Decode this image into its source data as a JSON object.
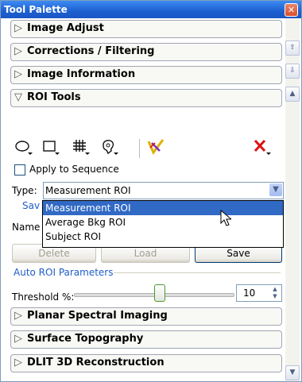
{
  "window": {
    "title": "Tool Palette",
    "close_icon": "close-icon"
  },
  "sections": [
    {
      "label": "Image Adjust",
      "state": "collapsed"
    },
    {
      "label": "Corrections / Filtering",
      "state": "collapsed"
    },
    {
      "label": "Image Information",
      "state": "collapsed"
    },
    {
      "label": "ROI Tools",
      "state": "expanded"
    },
    {
      "label": "Planar Spectral Imaging",
      "state": "collapsed"
    },
    {
      "label": "Surface Topography",
      "state": "collapsed"
    },
    {
      "label": "DLIT 3D Reconstruction",
      "state": "collapsed"
    }
  ],
  "roi_tools": {
    "tools": [
      "ellipse-roi-icon",
      "rectangle-roi-icon",
      "grid-roi-icon",
      "free-draw-roi-icon",
      "measure-roi-icon",
      "delete-roi-icon"
    ],
    "apply_to_sequence": "Apply to Sequence",
    "type_label": "Type:",
    "type_value": "Measurement ROI",
    "dropdown_options": [
      "Measurement ROI",
      "Average Bkg ROI",
      "Subject ROI"
    ],
    "save_group_legend": "Sav",
    "name_label": "Name",
    "buttons": {
      "delete": "Delete",
      "load": "Load",
      "save": "Save"
    },
    "auto_roi_legend": "Auto ROI Parameters",
    "threshold_label": "Threshold %:",
    "threshold_value": "10"
  },
  "colors": {
    "title_bar": "#1c5fd0",
    "selection": "#316ac5",
    "legend": "#1f5dc9"
  }
}
